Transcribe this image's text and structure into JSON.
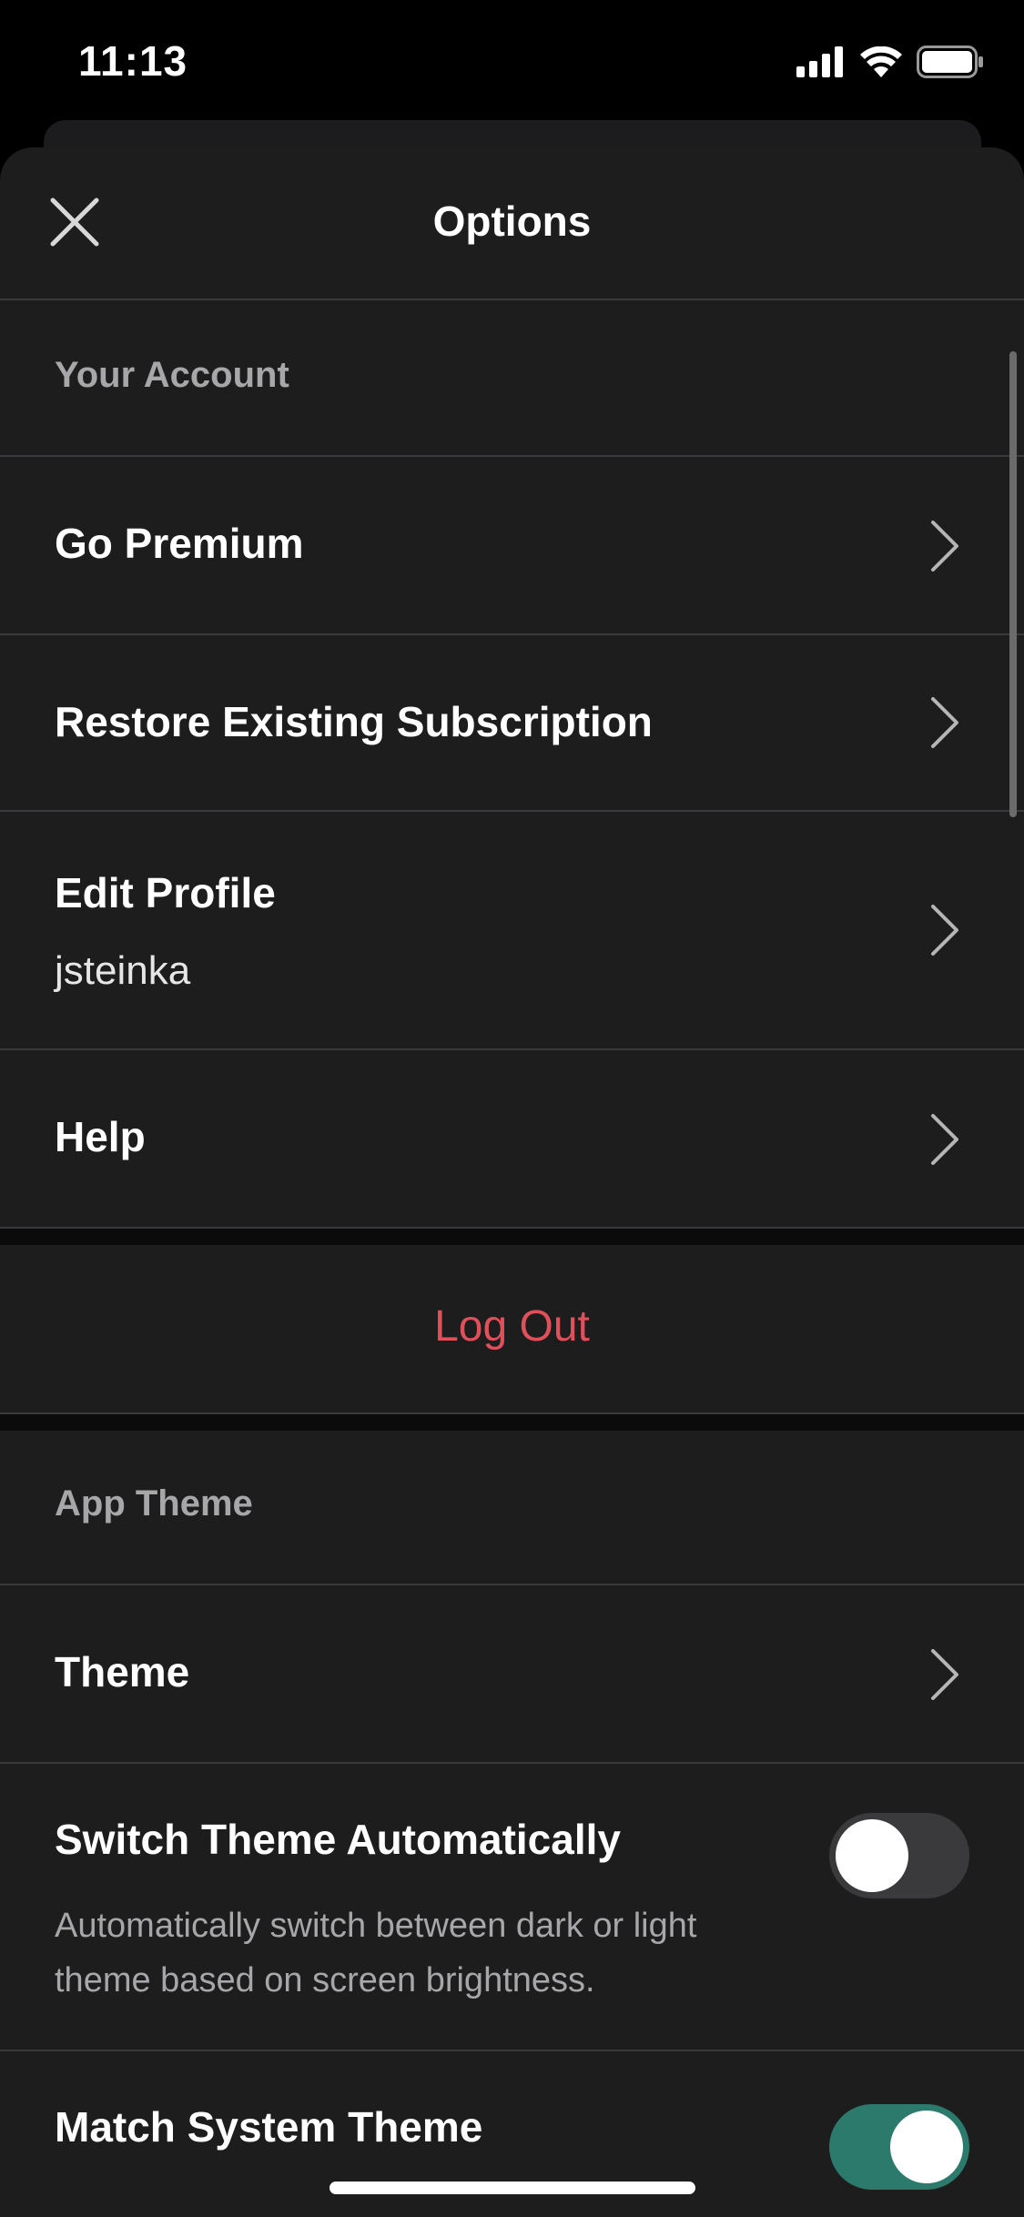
{
  "status": {
    "time": "11:13"
  },
  "header": {
    "title": "Options"
  },
  "account": {
    "section_label": "Your Account",
    "go_premium": "Go Premium",
    "restore": "Restore Existing Subscription",
    "edit_profile": "Edit Profile",
    "username": "jsteinka",
    "help": "Help"
  },
  "logout": {
    "label": "Log Out",
    "color": "#e0505b"
  },
  "theme": {
    "section_label": "App Theme",
    "theme_label": "Theme",
    "switch_auto_label": "Switch Theme Automatically",
    "switch_auto_desc": "Automatically switch between dark or light theme based on screen brightness.",
    "switch_auto_on": false,
    "match_system_label": "Match System Theme",
    "match_system_on": true
  },
  "colors": {
    "toggle_on": "#2c7a6b",
    "toggle_off": "#3a3a3c",
    "accent_red": "#e0505b"
  },
  "icons": [
    "close-icon",
    "chevron-right-icon",
    "signal-icon",
    "wifi-icon",
    "battery-icon"
  ]
}
